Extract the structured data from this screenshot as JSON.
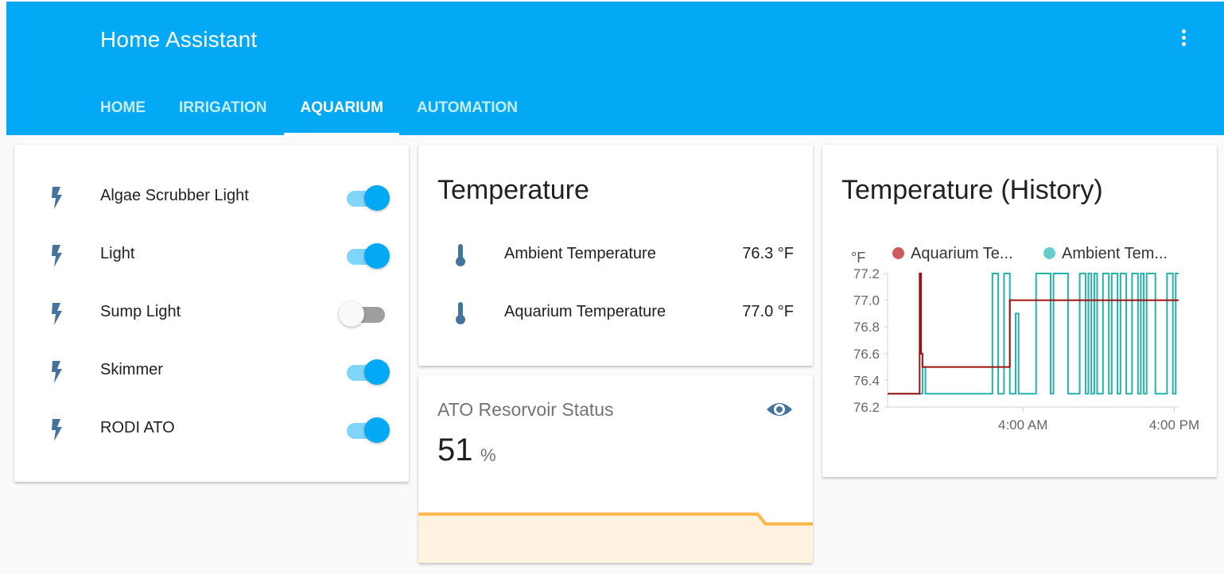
{
  "header": {
    "title": "Home Assistant",
    "menu_icon": "more-vert-icon",
    "tabs": [
      {
        "label": "HOME",
        "active": false
      },
      {
        "label": "IRRIGATION",
        "active": false
      },
      {
        "label": "AQUARIUM",
        "active": true
      },
      {
        "label": "AUTOMATION",
        "active": false
      }
    ]
  },
  "switches": {
    "icon": "flash-icon",
    "items": [
      {
        "label": "Algae Scrubber Light",
        "state": "on"
      },
      {
        "label": "Light",
        "state": "on"
      },
      {
        "label": "Sump Light",
        "state": "off"
      },
      {
        "label": "Skimmer",
        "state": "on"
      },
      {
        "label": "RODI ATO",
        "state": "on"
      }
    ]
  },
  "temperature": {
    "title": "Temperature",
    "icon": "thermometer-icon",
    "items": [
      {
        "label": "Ambient Temperature",
        "value": "76.3 °F"
      },
      {
        "label": "Aquarium Temperature",
        "value": "77.0 °F"
      }
    ]
  },
  "ato": {
    "title": "ATO Resorvoir Status",
    "icon": "eye-icon",
    "value": "51",
    "unit": "%"
  },
  "history": {
    "title": "Temperature (History)"
  },
  "colors": {
    "primary": "#03a9f4",
    "toggle_track": "#81d4fa",
    "icon": "#44739e",
    "aquarium_series": "#a31010",
    "ambient_series": "#24b2ab",
    "ato_line": "#ffb74d",
    "ato_fill": "#fff3e0"
  },
  "chart_data": [
    {
      "type": "line",
      "title": "Temperature (History)",
      "ylabel": "°F",
      "ylim": [
        76.2,
        77.2
      ],
      "yticks": [
        "77.2",
        "77.0",
        "76.8",
        "76.6",
        "76.4",
        "76.2"
      ],
      "xticks": [
        "4:00 AM",
        "4:00 PM"
      ],
      "legend": "top",
      "series": [
        {
          "name": "Aquarium Te...",
          "color": "#a31010",
          "step": true,
          "points": [
            [
              0.0,
              76.3
            ],
            [
              0.11,
              76.3
            ],
            [
              0.11,
              77.2
            ],
            [
              0.115,
              77.2
            ],
            [
              0.115,
              76.6
            ],
            [
              0.12,
              76.6
            ],
            [
              0.12,
              76.5
            ],
            [
              0.42,
              76.5
            ],
            [
              0.42,
              77.0
            ],
            [
              1.0,
              77.0
            ]
          ]
        },
        {
          "name": "Ambient Tem...",
          "color": "#24b2ab",
          "step": true,
          "points": [
            [
              0.0,
              76.3
            ],
            [
              0.12,
              76.3
            ],
            [
              0.12,
              76.5
            ],
            [
              0.13,
              76.5
            ],
            [
              0.13,
              76.3
            ],
            [
              0.36,
              76.3
            ],
            [
              0.36,
              77.2
            ],
            [
              0.38,
              77.2
            ],
            [
              0.38,
              76.3
            ],
            [
              0.4,
              76.3
            ],
            [
              0.4,
              77.2
            ],
            [
              0.42,
              77.2
            ],
            [
              0.42,
              76.3
            ],
            [
              0.44,
              76.3
            ],
            [
              0.44,
              76.9
            ],
            [
              0.45,
              76.9
            ],
            [
              0.45,
              76.3
            ],
            [
              0.51,
              76.3
            ],
            [
              0.51,
              77.2
            ],
            [
              0.56,
              77.2
            ],
            [
              0.56,
              76.3
            ],
            [
              0.57,
              76.3
            ],
            [
              0.57,
              77.2
            ],
            [
              0.62,
              77.2
            ],
            [
              0.62,
              76.3
            ],
            [
              0.66,
              76.3
            ],
            [
              0.66,
              77.2
            ],
            [
              0.68,
              77.2
            ],
            [
              0.68,
              76.3
            ],
            [
              0.69,
              76.3
            ],
            [
              0.69,
              77.2
            ],
            [
              0.7,
              77.2
            ],
            [
              0.7,
              76.3
            ],
            [
              0.71,
              76.3
            ],
            [
              0.71,
              77.2
            ],
            [
              0.72,
              77.2
            ],
            [
              0.72,
              76.3
            ],
            [
              0.74,
              76.3
            ],
            [
              0.74,
              77.2
            ],
            [
              0.76,
              77.2
            ],
            [
              0.76,
              76.3
            ],
            [
              0.77,
              76.3
            ],
            [
              0.77,
              77.2
            ],
            [
              0.79,
              77.2
            ],
            [
              0.79,
              76.3
            ],
            [
              0.8,
              76.3
            ],
            [
              0.8,
              77.2
            ],
            [
              0.82,
              77.2
            ],
            [
              0.82,
              76.3
            ],
            [
              0.84,
              76.3
            ],
            [
              0.84,
              77.2
            ],
            [
              0.86,
              77.2
            ],
            [
              0.86,
              76.3
            ],
            [
              0.87,
              76.3
            ],
            [
              0.87,
              77.2
            ],
            [
              0.88,
              77.2
            ],
            [
              0.88,
              76.3
            ],
            [
              0.89,
              76.3
            ],
            [
              0.89,
              77.2
            ],
            [
              0.92,
              77.2
            ],
            [
              0.92,
              76.3
            ],
            [
              0.96,
              76.3
            ],
            [
              0.96,
              77.2
            ],
            [
              0.98,
              77.2
            ],
            [
              0.98,
              76.3
            ],
            [
              0.99,
              76.3
            ],
            [
              0.99,
              77.2
            ],
            [
              1.0,
              77.2
            ]
          ]
        }
      ]
    },
    {
      "type": "area",
      "title": "ATO Resorvoir Status",
      "series": [
        {
          "name": "",
          "color": "#ffb74d",
          "points": [
            [
              0.0,
              0.64
            ],
            [
              0.86,
              0.64
            ],
            [
              0.88,
              0.51
            ],
            [
              1.0,
              0.51
            ]
          ]
        }
      ]
    }
  ]
}
